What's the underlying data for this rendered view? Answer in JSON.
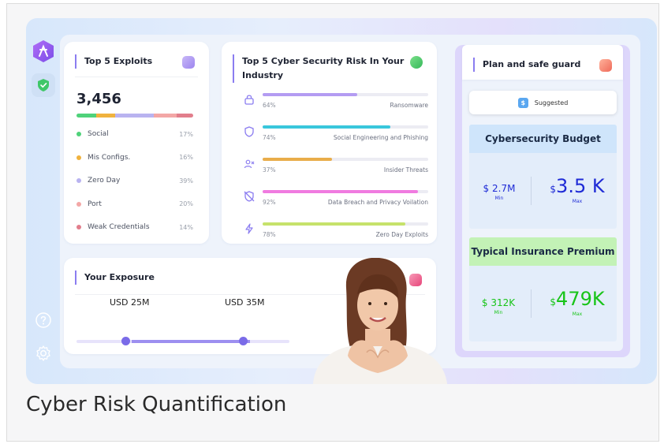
{
  "caption": "Cyber Risk Quantification",
  "sidebar": {
    "logo_icon": "brand-logo-icon",
    "active_icon": "shield-check-icon",
    "bottom_icons": [
      "help-icon",
      "settings-icon"
    ]
  },
  "exploits": {
    "title": "Top 5 Exploits",
    "total": "3,456",
    "items": [
      {
        "label": "Social",
        "pct": "17%",
        "color": "#4fd27a"
      },
      {
        "label": "Mis Configs.",
        "pct": "16%",
        "color": "#f0b23e"
      },
      {
        "label": "Zero Day",
        "pct": "39%",
        "color": "#b9b3f0"
      },
      {
        "label": "Port",
        "pct": "20%",
        "color": "#f3a7a6"
      },
      {
        "label": "Weak Credentials",
        "pct": "14%",
        "color": "#e27e8c"
      }
    ]
  },
  "risks": {
    "title": "Top 5 Cyber Security Risk In Your Industry",
    "items": [
      {
        "label": "Ransomware",
        "pct": "64%",
        "value": 0.57,
        "color": "#b49cf2",
        "icon": "lock-icon"
      },
      {
        "label": "Social Engineering and Phishing",
        "pct": "74%",
        "value": 0.77,
        "color": "#39c7dc",
        "icon": "shield-icon"
      },
      {
        "label": "Insider Threats",
        "pct": "37%",
        "value": 0.42,
        "color": "#e9ad4a",
        "icon": "user-x-icon"
      },
      {
        "label": "Data Breach and Privacy Voilation",
        "pct": "92%",
        "value": 0.94,
        "color": "#f07be0",
        "icon": "shield-off-icon"
      },
      {
        "label": "Zero Day Exploits",
        "pct": "78%",
        "value": 0.86,
        "color": "#c6e26b",
        "icon": "bolt-icon"
      }
    ]
  },
  "exposure": {
    "title": "Your Exposure",
    "min_label": "USD 25M",
    "max_label": "USD 35M"
  },
  "plan": {
    "title": "Plan and safe guard",
    "suggested_label": "Suggested",
    "budget": {
      "title": "Cybersecurity Budget",
      "min_value": "$ 2.7M",
      "min_caption": "Min",
      "max_currency": "$",
      "max_value": "3.5 K",
      "max_caption": "Max",
      "head_color": "#cfe5fb",
      "value_color": "#1f2bd6"
    },
    "premium": {
      "title": "Typical Insurance Premium",
      "min_value": "$ 312K",
      "min_caption": "Min",
      "max_currency": "$",
      "max_value": "479K",
      "max_caption": "Max",
      "head_color": "#c3f2b6",
      "value_color": "#18c418"
    }
  }
}
